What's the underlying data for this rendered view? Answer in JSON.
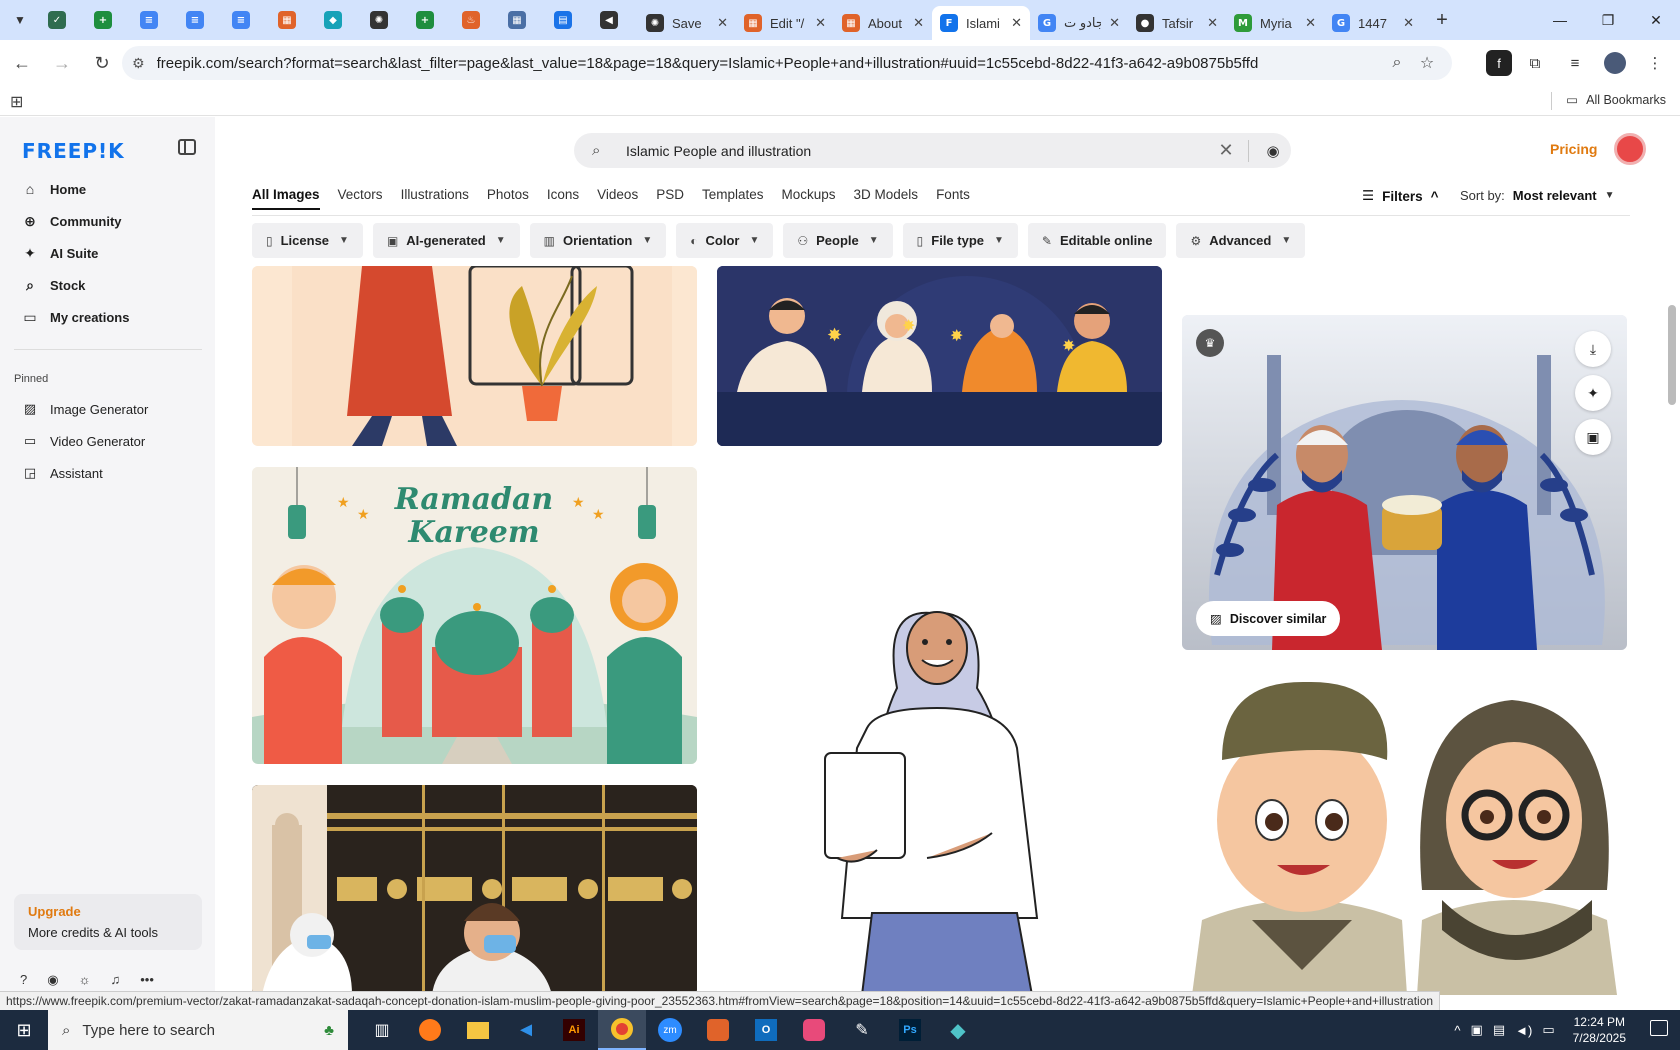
{
  "browser": {
    "pinned_tabs": [
      {
        "icon": "vpn-icon",
        "color": "#2f6c4f",
        "glyph": "✓"
      },
      {
        "icon": "sheets-icon",
        "color": "#1e8e3e",
        "glyph": "+"
      },
      {
        "icon": "docs-icon",
        "color": "#4285f4",
        "glyph": "≡"
      },
      {
        "icon": "docs-icon",
        "color": "#4285f4",
        "glyph": "≡"
      },
      {
        "icon": "docs-icon",
        "color": "#4285f4",
        "glyph": "≡"
      },
      {
        "icon": "brand-icon",
        "color": "#e0632a",
        "glyph": "▦"
      },
      {
        "icon": "bookmark-app-icon",
        "color": "#17a2b8",
        "glyph": "◆"
      },
      {
        "icon": "openai-icon",
        "color": "#333333",
        "glyph": "✺"
      },
      {
        "icon": "sheets-icon",
        "color": "#1e8e3e",
        "glyph": "+"
      },
      {
        "icon": "app-icon",
        "color": "#e0632a",
        "glyph": "♨"
      },
      {
        "icon": "grid-app-icon",
        "color": "#4a6fa5",
        "glyph": "▦"
      },
      {
        "icon": "forms-icon",
        "color": "#1a73e8",
        "glyph": "▤"
      },
      {
        "icon": "speaker-icon",
        "color": "#333333",
        "glyph": "◀"
      }
    ],
    "tabs": [
      {
        "title": "Save",
        "icon": "openai-icon",
        "color": "#333333",
        "glyph": "✺",
        "active": false
      },
      {
        "title": "Edit \"/",
        "icon": "brand-icon",
        "color": "#e0632a",
        "glyph": "▦",
        "active": false
      },
      {
        "title": "About",
        "icon": "brand-icon",
        "color": "#e0632a",
        "glyph": "▦",
        "active": false
      },
      {
        "title": "Islami",
        "icon": "freepik-icon",
        "color": "#1273eb",
        "glyph": "F",
        "active": true
      },
      {
        "title": "جادو ت",
        "icon": "google-icon",
        "color": "#4285f4",
        "glyph": "G",
        "active": false
      },
      {
        "title": "Tafsir",
        "icon": "tafsir-icon",
        "color": "#333333",
        "glyph": "●",
        "active": false
      },
      {
        "title": "Myria",
        "icon": "myria-icon",
        "color": "#2e9b3a",
        "glyph": "M",
        "active": false
      },
      {
        "title": "1447",
        "icon": "google-icon",
        "color": "#4285f4",
        "glyph": "G",
        "active": false
      }
    ],
    "url": "freepik.com/search?format=search&last_filter=page&last_value=18&page=18&query=Islamic+People+and+illustration#uuid=1c55cebd-8d22-41f3-a642-a9b0875b5ffd",
    "all_bookmarks": "All Bookmarks",
    "status_url": "https://www.freepik.com/premium-vector/zakat-ramadanzakat-sadaqah-concept-donation-islam-muslim-people-giving-poor_23552363.htm#fromView=search&page=18&position=14&uuid=1c55cebd-8d22-41f3-a642-a9b0875b5ffd&query=Islamic+People+and+illustration"
  },
  "sidebar": {
    "logo": "FREEP!K",
    "nav": [
      {
        "label": "Home",
        "icon": "home-icon",
        "glyph": "⌂"
      },
      {
        "label": "Community",
        "icon": "globe-icon",
        "glyph": "⊕"
      },
      {
        "label": "AI Suite",
        "icon": "sparkle-icon",
        "glyph": "✦"
      },
      {
        "label": "Stock",
        "icon": "search-icon",
        "glyph": "⌕"
      },
      {
        "label": "My creations",
        "icon": "folder-icon",
        "glyph": "▭"
      }
    ],
    "pinned_label": "Pinned",
    "pinned": [
      {
        "label": "Image Generator",
        "icon": "image-icon",
        "glyph": "▨"
      },
      {
        "label": "Video Generator",
        "icon": "video-icon",
        "glyph": "▭"
      },
      {
        "label": "Assistant",
        "icon": "assistant-icon",
        "glyph": "◲"
      }
    ],
    "upgrade_title": "Upgrade",
    "upgrade_sub": "More credits & AI tools"
  },
  "header": {
    "search_value": "Islamic People and illustration",
    "pricing": "Pricing",
    "type_tabs": [
      "All Images",
      "Vectors",
      "Illustrations",
      "Photos",
      "Icons",
      "Videos",
      "PSD",
      "Templates",
      "Mockups",
      "3D Models",
      "Fonts"
    ],
    "filters_label": "Filters",
    "sort_label": "Sort by:",
    "sort_value": "Most relevant",
    "chips": [
      {
        "label": "License",
        "icon": "license-icon",
        "glyph": "▯",
        "dropdown": true
      },
      {
        "label": "AI-generated",
        "icon": "ai-icon",
        "glyph": "▣",
        "dropdown": true
      },
      {
        "label": "Orientation",
        "icon": "orientation-icon",
        "glyph": "▥",
        "dropdown": true
      },
      {
        "label": "Color",
        "icon": "palette-icon",
        "glyph": "◐",
        "dropdown": true
      },
      {
        "label": "People",
        "icon": "people-icon",
        "glyph": "⚇",
        "dropdown": true
      },
      {
        "label": "File type",
        "icon": "file-icon",
        "glyph": "▯",
        "dropdown": true
      },
      {
        "label": "Editable online",
        "icon": "pen-icon",
        "glyph": "✎",
        "dropdown": false
      },
      {
        "label": "Advanced",
        "icon": "settings-icon",
        "glyph": "⚙",
        "dropdown": true
      }
    ]
  },
  "grid": {
    "ramadan_line1": "Ramadan",
    "ramadan_line2": "Kareem",
    "discover_similar": "Discover similar"
  },
  "taskbar": {
    "search_placeholder": "Type here to search",
    "time": "12:24 PM",
    "date": "7/28/2025"
  }
}
